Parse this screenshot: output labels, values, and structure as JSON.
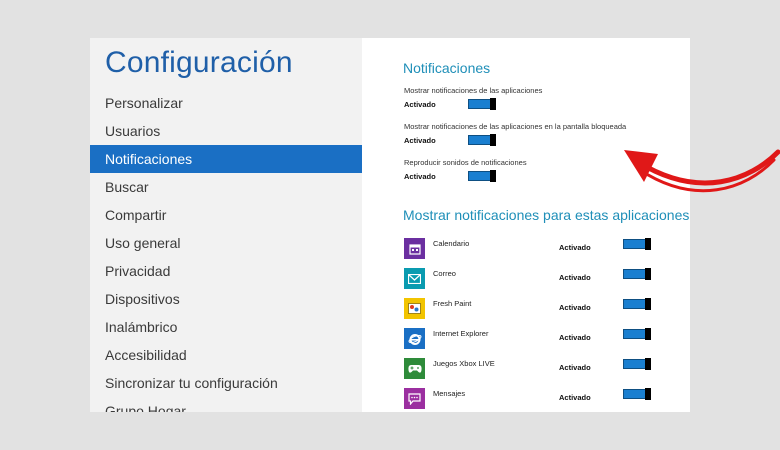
{
  "left_pane": {
    "title": "Configuración",
    "menu": [
      {
        "label": "Personalizar"
      },
      {
        "label": "Usuarios"
      },
      {
        "label": "Notificaciones"
      },
      {
        "label": "Buscar"
      },
      {
        "label": "Compartir"
      },
      {
        "label": "Uso general"
      },
      {
        "label": "Privacidad"
      },
      {
        "label": "Dispositivos"
      },
      {
        "label": "Inalámbrico"
      },
      {
        "label": "Accesibilidad"
      },
      {
        "label": "Sincronizar tu configuración"
      },
      {
        "label": "Grupo Hogar"
      }
    ],
    "selected_index": 2
  },
  "right_pane": {
    "section_title": "Notificaciones",
    "settings": [
      {
        "description": "Mostrar notificaciones de las aplicaciones",
        "state": "Activado",
        "on": true
      },
      {
        "description": "Mostrar notificaciones de las aplicaciones en la pantalla bloqueada",
        "state": "Activado",
        "on": true
      },
      {
        "description": "Reproducir sonidos de notificaciones",
        "state": "Activado",
        "on": true
      }
    ],
    "apps_title": "Mostrar notificaciones para estas aplicaciones",
    "apps": [
      {
        "name": "Calendario",
        "state": "Activado",
        "on": true,
        "icon": "calendar-icon",
        "color": "#6b2fa0"
      },
      {
        "name": "Correo",
        "state": "Activado",
        "on": true,
        "icon": "mail-icon",
        "color": "#0a9bb0"
      },
      {
        "name": "Fresh Paint",
        "state": "Activado",
        "on": true,
        "icon": "paint-icon",
        "color": "#f2c400"
      },
      {
        "name": "Internet Explorer",
        "state": "Activado",
        "on": true,
        "icon": "ie-icon",
        "color": "#1a6fc4"
      },
      {
        "name": "Juegos Xbox LIVE",
        "state": "Activado",
        "on": true,
        "icon": "gamepad-icon",
        "color": "#2e8b3a"
      },
      {
        "name": "Mensajes",
        "state": "Activado",
        "on": true,
        "icon": "message-icon",
        "color": "#9b2fa0"
      }
    ]
  },
  "colors": {
    "accent": "#1a6fc4",
    "toggle_on": "#1a7fd0",
    "arrow": "#e01818"
  }
}
